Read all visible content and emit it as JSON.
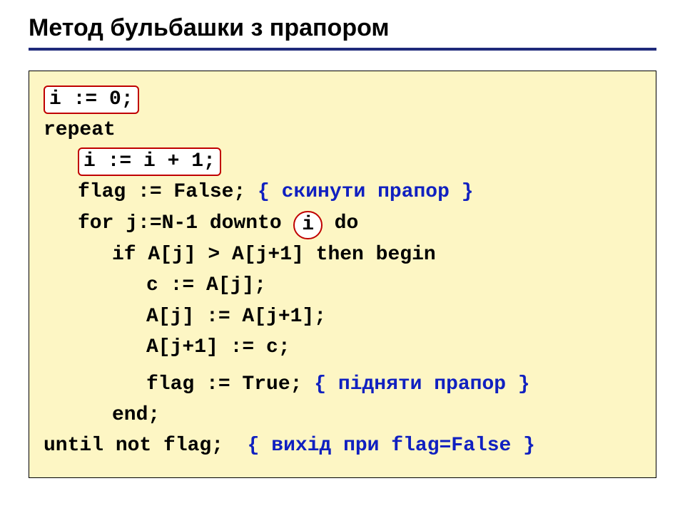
{
  "title": "Метод бульбашки з прапором",
  "code": {
    "l1": "i := 0;",
    "l2": "repeat",
    "l3": "i := i + 1;",
    "l4a": "flag := False; ",
    "l4b": "{ скинути прапор }",
    "l5a": "for j:=N-1 downto ",
    "l5b": "i",
    "l5c": " do",
    "l6": "if A[j] > A[j+1] then begin",
    "l7": "с := A[j];",
    "l8": "A[j] := A[j+1];",
    "l9": "A[j+1] := с;",
    "l10a": "flag := True; ",
    "l10b": "{ підняти прапор }",
    "l11": "end;",
    "l12a": "until not flag;  ",
    "l12b": "{ вихід при flag=False }"
  }
}
